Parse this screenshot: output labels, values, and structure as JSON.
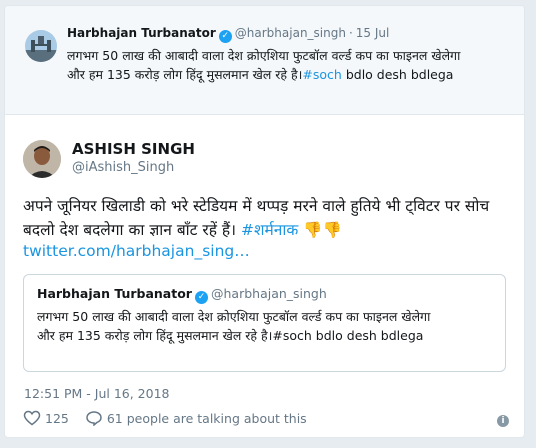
{
  "parent_tweet": {
    "name": "Harbhajan Turbanator",
    "handle": "@harbhajan_singh",
    "separator": "·",
    "date": "15 Jul",
    "text_line1": "लगभग 50 लाख की आबादी वाला देश क्रोएशिया फुटबॉल वर्ल्ड कप का फाइनल खेलेगा",
    "text_line2_plain": "और हम 135 करोड़ लोग हिंदू मुसलमान खेल रहे है।",
    "text_line2_tag": "#soch",
    "text_line2_rest": " bdlo desh bdlega"
  },
  "main_tweet": {
    "name": "ASHISH SINGH",
    "handle": "@iAshish_Singh",
    "text": "अपने जूनियर खिलाडी को भरे स्टेडियम में थप्पड़ मरने वाले हुतिये भी ट्विटर पर सोच बदलो देश बदलेगा का ज्ञान बाँट रहें हैं।",
    "hashtag": "#शर्मनाक",
    "emoji": "👎👎",
    "link": "twitter.com/harbhajan_sing…",
    "timestamp": "12:51 PM - Jul 16, 2018",
    "likes": "125",
    "talking": "61 people are talking about this"
  },
  "quoted_tweet": {
    "name": "Harbhajan Turbanator",
    "handle": "@harbhajan_singh",
    "text_line1": "लगभग 50 लाख की आबादी वाला देश क्रोएशिया फुटबॉल वर्ल्ड कप का फाइनल खेलेगा",
    "text_line2": "और हम 135 करोड़ लोग हिंदू मुसलमान खेल रहे है।#soch bdlo desh bdlega"
  },
  "icons": {
    "verified": "verified-badge-icon",
    "like": "heart-icon",
    "reply": "speech-bubble-icon",
    "info": "info-icon"
  },
  "colors": {
    "link": "#1b95e0",
    "verified": "#1da1f2",
    "muted": "#657786"
  }
}
